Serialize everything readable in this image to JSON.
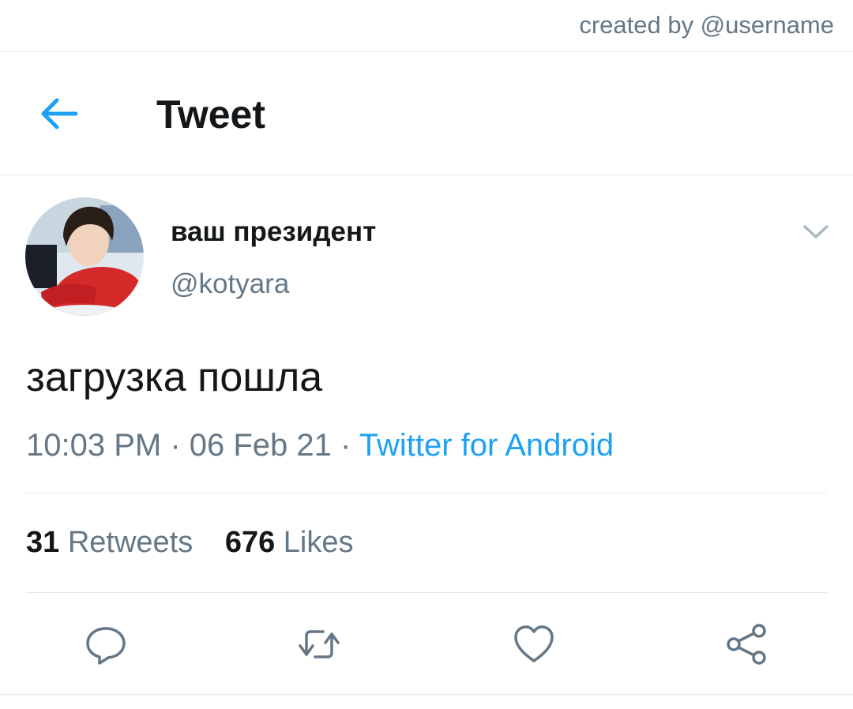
{
  "credit": {
    "text": "created by @username"
  },
  "header": {
    "back_icon": "arrow-left-icon",
    "title": "Tweet"
  },
  "tweet": {
    "author": {
      "display_name": "ваш президент",
      "handle": "@kotyara"
    },
    "text": "загрузка пошла",
    "time": "10:03 PM",
    "separator1": " · ",
    "date": "06 Feb 21",
    "separator2": " · ",
    "source": "Twitter for Android",
    "stats": {
      "retweets_count": "31",
      "retweets_label": "Retweets",
      "likes_count": "676",
      "likes_label": "Likes"
    }
  },
  "actions": {
    "icons": [
      "reply-icon",
      "retweet-icon",
      "like-icon",
      "share-icon"
    ]
  },
  "colors": {
    "accent": "#1da1f2",
    "text_primary": "#14171a",
    "text_secondary": "#657786",
    "divider": "#e1e8ed"
  }
}
